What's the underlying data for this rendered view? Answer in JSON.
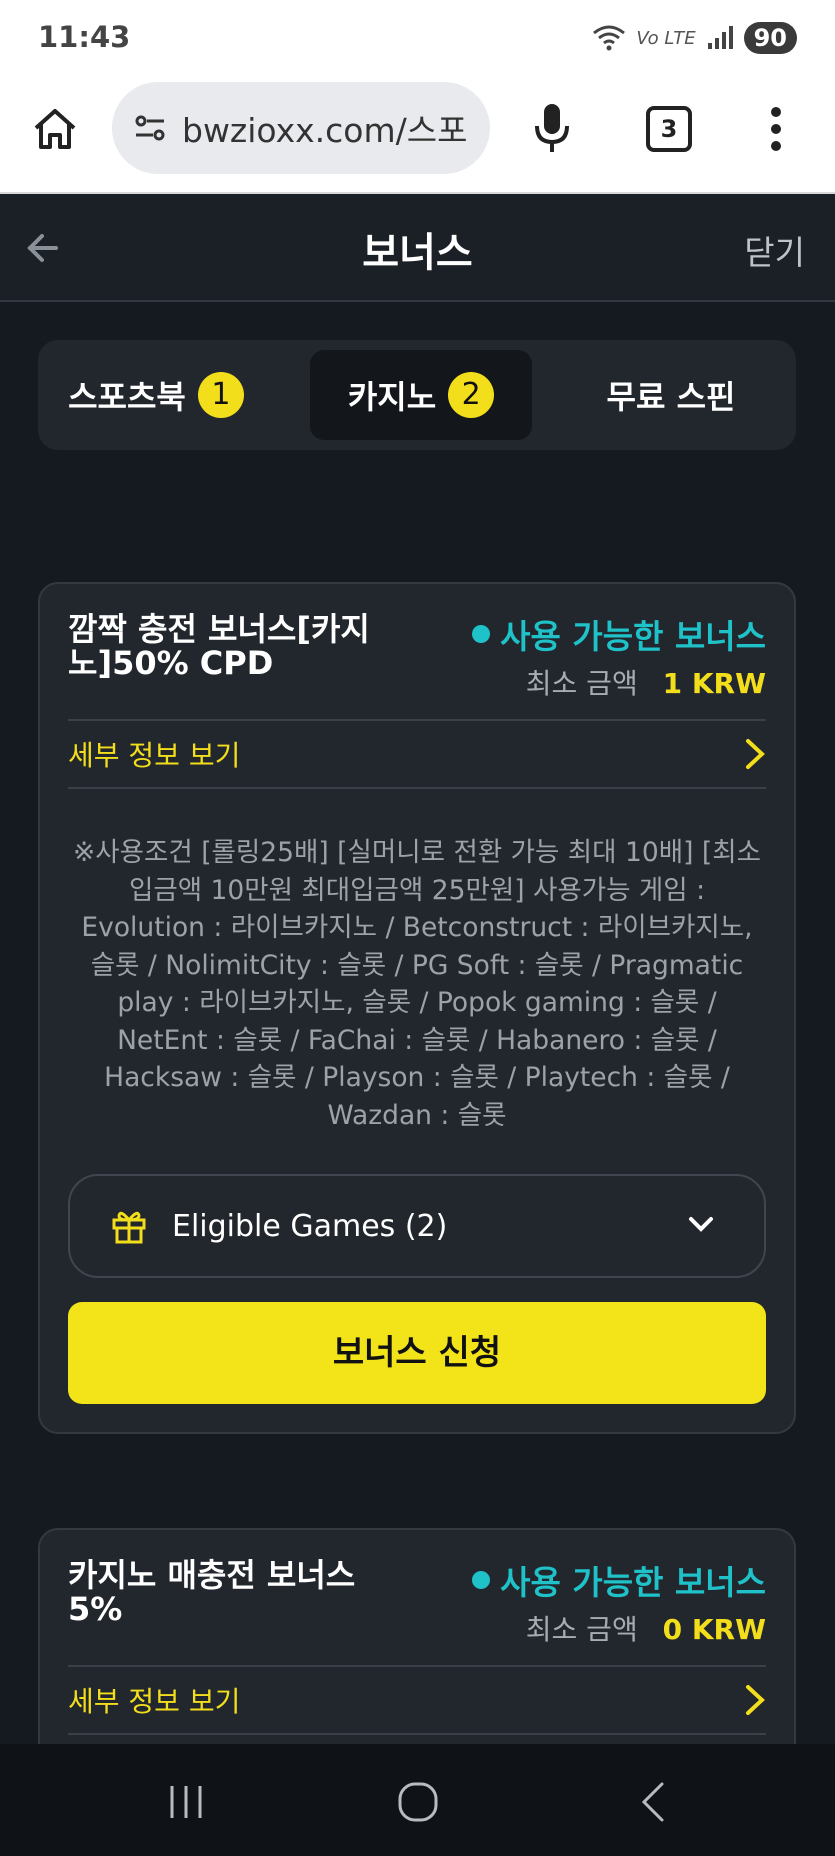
{
  "status_bar": {
    "time": "11:43",
    "network": "Vo LTE",
    "battery": "90"
  },
  "browser": {
    "url": "bwzioxx.com/스포",
    "tab_count": "3"
  },
  "header": {
    "title": "보너스",
    "close_label": "닫기"
  },
  "tabs": [
    {
      "label": "스포츠북",
      "badge": "1",
      "active": false
    },
    {
      "label": "카지노",
      "badge": "2",
      "active": true
    },
    {
      "label": "무료 스핀",
      "badge": "",
      "active": false
    }
  ],
  "bonuses": [
    {
      "title": "깜짝 충전 보너스[카지노]50% CPD",
      "status": "사용 가능한 보너스",
      "min_label": "최소 금액",
      "min_amount": "1 KRW",
      "details_label": "세부 정보 보기",
      "terms": "※사용조건 [롤링25배] [실머니로 전환 가능 최대 10배] [최소입금액 10만원 최대입금액 25만원] 사용가능 게임 : Evolution : 라이브카지노 / Betconstruct : 라이브카지노, 슬롯 / NolimitCity : 슬롯 / PG Soft : 슬롯 / Pragmatic play : 라이브카지노, 슬롯 / Popok gaming : 슬롯 / NetEnt : 슬롯 / FaChai : 슬롯 / Habanero : 슬롯 / Hacksaw : 슬롯 / Playson : 슬롯 / Playtech : 슬롯 / Wazdan : 슬롯",
      "eligible_label": "Eligible Games (2)",
      "apply_label": "보너스 신청"
    },
    {
      "title": "카지노 매충전 보너스 5%",
      "status": "사용 가능한 보너스",
      "min_label": "최소 금액",
      "min_amount": "0 KRW",
      "details_label": "세부 정보 보기"
    }
  ],
  "colors": {
    "accent_yellow": "#f3de1b",
    "status_teal": "#1ec2c8",
    "background": "#151a21"
  }
}
